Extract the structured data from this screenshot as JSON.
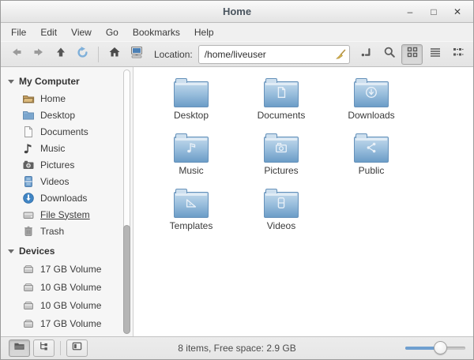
{
  "window": {
    "title": "Home",
    "controls": {
      "minimize": "–",
      "maximize": "□",
      "close": "✕"
    }
  },
  "menubar": {
    "items": [
      {
        "label": "File"
      },
      {
        "label": "Edit"
      },
      {
        "label": "View"
      },
      {
        "label": "Go"
      },
      {
        "label": "Bookmarks"
      },
      {
        "label": "Help"
      }
    ]
  },
  "toolbar": {
    "icons": [
      "back-icon",
      "forward-icon",
      "up-icon",
      "refresh-icon",
      "home-icon",
      "computer-icon",
      "clear-entry-broom-icon",
      "toggle-location-entry-icon",
      "search-icon",
      "icon-view-icon",
      "list-view-icon",
      "compact-view-icon"
    ],
    "location_label": "Location:",
    "location_value": "/home/liveuser"
  },
  "sidebar": {
    "sections": [
      {
        "header": "My Computer",
        "items": [
          {
            "label": "Home",
            "icon": "home-folder-icon"
          },
          {
            "label": "Desktop",
            "icon": "folder-icon"
          },
          {
            "label": "Documents",
            "icon": "document-icon"
          },
          {
            "label": "Music",
            "icon": "music-note-icon"
          },
          {
            "label": "Pictures",
            "icon": "camera-icon"
          },
          {
            "label": "Videos",
            "icon": "video-icon"
          },
          {
            "label": "Downloads",
            "icon": "download-icon"
          },
          {
            "label": "File System",
            "icon": "drive-icon"
          },
          {
            "label": "Trash",
            "icon": "trash-icon"
          }
        ]
      },
      {
        "header": "Devices",
        "items": [
          {
            "label": "17 GB Volume",
            "icon": "volume-icon"
          },
          {
            "label": "10 GB Volume",
            "icon": "volume-icon"
          },
          {
            "label": "10 GB Volume",
            "icon": "volume-icon"
          },
          {
            "label": "17 GB Volume",
            "icon": "volume-icon"
          }
        ]
      }
    ]
  },
  "main": {
    "folders": [
      {
        "label": "Desktop",
        "emblem": "none"
      },
      {
        "label": "Documents",
        "emblem": "document-emblem-icon"
      },
      {
        "label": "Downloads",
        "emblem": "download-emblem-icon"
      },
      {
        "label": "Music",
        "emblem": "music-emblem-icon"
      },
      {
        "label": "Pictures",
        "emblem": "camera-emblem-icon"
      },
      {
        "label": "Public",
        "emblem": "share-emblem-icon"
      },
      {
        "label": "Templates",
        "emblem": "template-emblem-icon"
      },
      {
        "label": "Videos",
        "emblem": "film-emblem-icon"
      }
    ]
  },
  "statusbar": {
    "status_text": "8 items, Free space: 2.9 GB"
  },
  "colors": {
    "folder_top": "#c2d9ec",
    "folder_bottom": "#6c9dc7",
    "accent_blue": "#6f9fd0",
    "chrome_bg": "#ececec",
    "sidebar_bg": "#f6f6f6"
  }
}
